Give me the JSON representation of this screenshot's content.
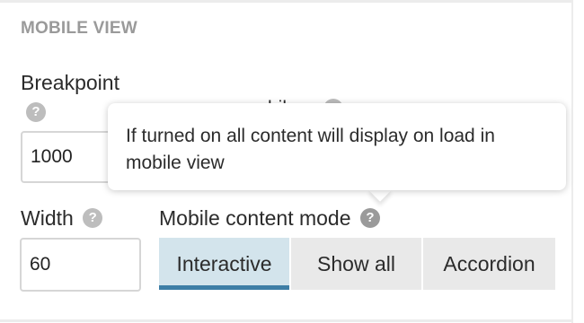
{
  "section": {
    "title": "MOBILE VIEW"
  },
  "breakpoint": {
    "label": "Breakpoint",
    "help_icon": "question-circle-icon",
    "value": "1000"
  },
  "hidden_field": {
    "label_fragment": "bile",
    "help_icon": "question-circle-icon"
  },
  "width": {
    "label": "Width",
    "help_icon": "question-circle-icon",
    "value": "60"
  },
  "content_mode": {
    "label": "Mobile content mode",
    "help_icon": "question-circle-icon",
    "options": [
      "Interactive",
      "Show all",
      "Accordion"
    ],
    "selected": "Interactive"
  },
  "tooltip": {
    "text": "If turned on all content will display on load in mobile view"
  },
  "colors": {
    "active_bg": "#d3e4ec",
    "active_underline": "#3d7ea6",
    "segment_bg": "#e9e9e9",
    "section_title": "#9a9a9a"
  }
}
